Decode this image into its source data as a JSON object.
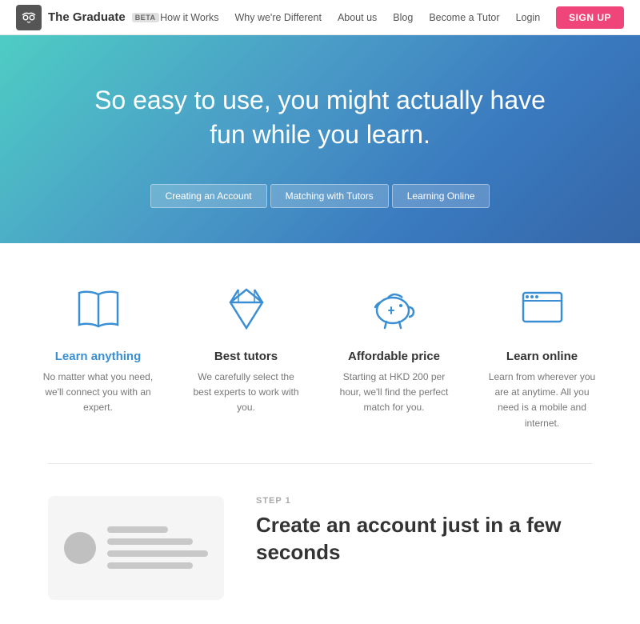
{
  "header": {
    "logo_text": "The Graduate",
    "beta_label": "BETA",
    "nav": [
      {
        "label": "How it Works",
        "id": "how-it-works"
      },
      {
        "label": "Why we're Different",
        "id": "why-different"
      },
      {
        "label": "About us",
        "id": "about"
      },
      {
        "label": "Blog",
        "id": "blog"
      },
      {
        "label": "Become a Tutor",
        "id": "become-tutor"
      },
      {
        "label": "Login",
        "id": "login"
      }
    ],
    "signup_label": "SIGN UP"
  },
  "hero": {
    "title": "So easy to use, you might actually have fun while you learn.",
    "tabs": [
      {
        "label": "Creating an Account"
      },
      {
        "label": "Matching with Tutors"
      },
      {
        "label": "Learning Online"
      }
    ]
  },
  "features": [
    {
      "id": "learn-anything",
      "title": "Learn anything",
      "desc": "No matter what you need, we'll connect you with an expert.",
      "title_blue": true,
      "icon": "book"
    },
    {
      "id": "best-tutors",
      "title": "Best tutors",
      "desc": "We carefully select the best experts to work with you.",
      "title_blue": false,
      "icon": "diamond"
    },
    {
      "id": "affordable-price",
      "title": "Affordable price",
      "desc": "Starting at HKD 200 per hour, we'll find the perfect match for you.",
      "title_blue": false,
      "icon": "piggy"
    },
    {
      "id": "learn-online",
      "title": "Learn online",
      "desc": "Learn from wherever you are at anytime. All you need is a mobile and internet.",
      "title_blue": false,
      "icon": "monitor"
    }
  ],
  "step": {
    "label": "STEP 1",
    "title": "Create an account just in a few seconds"
  }
}
